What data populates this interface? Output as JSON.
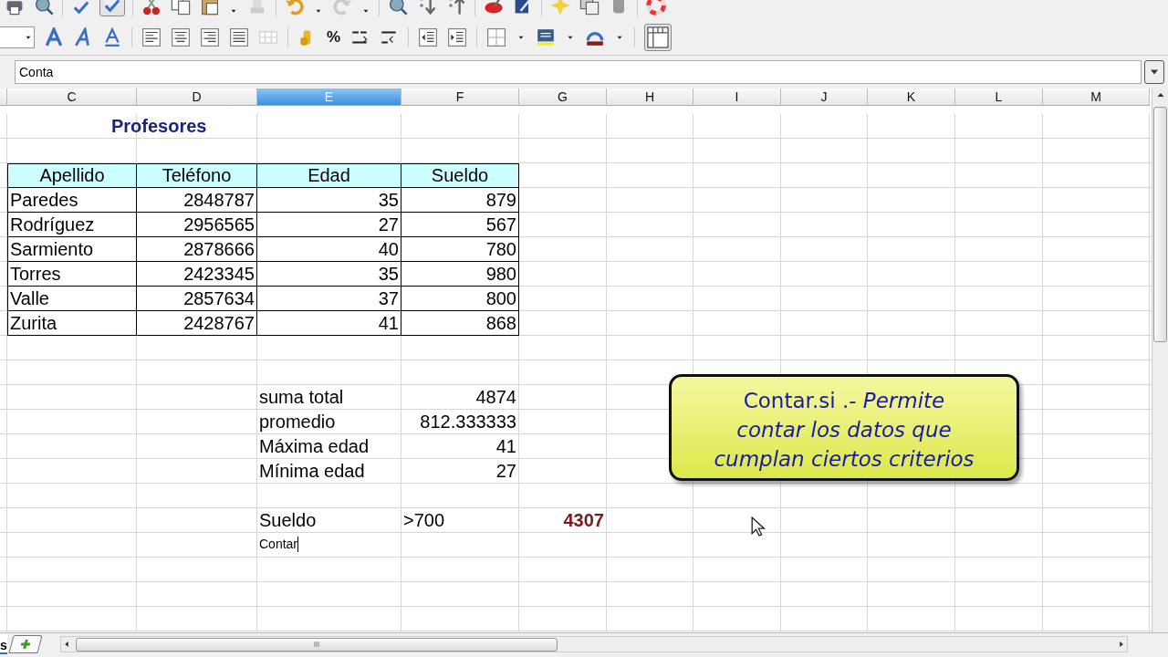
{
  "formula_bar": {
    "value": "Conta"
  },
  "toolbar": {
    "percent": "%"
  },
  "columns": [
    {
      "label": "C",
      "selected": false
    },
    {
      "label": "D",
      "selected": false
    },
    {
      "label": "E",
      "selected": true
    },
    {
      "label": "F",
      "selected": false
    },
    {
      "label": "G",
      "selected": false
    },
    {
      "label": "H",
      "selected": false
    },
    {
      "label": "I",
      "selected": false
    },
    {
      "label": "J",
      "selected": false
    },
    {
      "label": "K",
      "selected": false
    },
    {
      "label": "L",
      "selected": false
    },
    {
      "label": "M",
      "selected": false
    }
  ],
  "rows": [
    {
      "cells": [
        {
          "kind": "title",
          "text": "Profesores"
        }
      ]
    },
    {
      "cells": []
    },
    {
      "cells": [
        {
          "kind": "header",
          "text": "Apellido"
        },
        {
          "kind": "header",
          "text": "Teléfono"
        },
        {
          "kind": "header",
          "text": "Edad"
        },
        {
          "kind": "header",
          "text": "Sueldo"
        }
      ]
    },
    {
      "cells": [
        {
          "kind": "text",
          "text": "Paredes"
        },
        {
          "kind": "number",
          "text": "2848787"
        },
        {
          "kind": "number",
          "text": "35"
        },
        {
          "kind": "number",
          "text": "879"
        }
      ]
    },
    {
      "cells": [
        {
          "kind": "text",
          "text": "Rodríguez"
        },
        {
          "kind": "number",
          "text": "2956565"
        },
        {
          "kind": "number",
          "text": "27"
        },
        {
          "kind": "number",
          "text": "567"
        }
      ]
    },
    {
      "cells": [
        {
          "kind": "text",
          "text": "Sarmiento"
        },
        {
          "kind": "number",
          "text": "2878666"
        },
        {
          "kind": "number",
          "text": "40"
        },
        {
          "kind": "number",
          "text": "780"
        }
      ]
    },
    {
      "cells": [
        {
          "kind": "text",
          "text": "Torres"
        },
        {
          "kind": "number",
          "text": "2423345"
        },
        {
          "kind": "number",
          "text": "35"
        },
        {
          "kind": "number",
          "text": "980"
        }
      ]
    },
    {
      "cells": [
        {
          "kind": "text",
          "text": "Valle"
        },
        {
          "kind": "number",
          "text": "2857634"
        },
        {
          "kind": "number",
          "text": "37"
        },
        {
          "kind": "number",
          "text": "800"
        }
      ]
    },
    {
      "cells": [
        {
          "kind": "text",
          "text": "Zurita"
        },
        {
          "kind": "number",
          "text": "2428767"
        },
        {
          "kind": "number",
          "text": "41"
        },
        {
          "kind": "number",
          "text": "868"
        }
      ]
    },
    {
      "cells": []
    },
    {
      "cells": []
    },
    {
      "cells": [
        {
          "kind": "empty"
        },
        {
          "kind": "empty"
        },
        {
          "kind": "label",
          "text": "suma total"
        },
        {
          "kind": "value",
          "text": "4874"
        }
      ]
    },
    {
      "cells": [
        {
          "kind": "empty"
        },
        {
          "kind": "empty"
        },
        {
          "kind": "label",
          "text": "promedio"
        },
        {
          "kind": "value",
          "text": "812.333333"
        }
      ]
    },
    {
      "cells": [
        {
          "kind": "empty"
        },
        {
          "kind": "empty"
        },
        {
          "kind": "label",
          "text": "Máxima edad"
        },
        {
          "kind": "value",
          "text": "41"
        }
      ]
    },
    {
      "cells": [
        {
          "kind": "empty"
        },
        {
          "kind": "empty"
        },
        {
          "kind": "label",
          "text": "Mínima edad"
        },
        {
          "kind": "value",
          "text": "27"
        }
      ]
    },
    {
      "cells": []
    },
    {
      "cells": [
        {
          "kind": "empty"
        },
        {
          "kind": "empty"
        },
        {
          "kind": "label",
          "text": "Sueldo"
        },
        {
          "kind": "label",
          "text": ">700"
        },
        {
          "kind": "result",
          "text": "4307"
        }
      ]
    },
    {
      "cells": [
        {
          "kind": "empty"
        },
        {
          "kind": "empty"
        },
        {
          "kind": "editing",
          "text": "Contar"
        }
      ]
    },
    {
      "cells": []
    },
    {
      "cells": []
    },
    {
      "cells": []
    }
  ],
  "callout": {
    "text": "Contar.si .- *Permite contar los datos que cumplan ciertos criterios*"
  },
  "sheet_tabs": [
    {
      "label": "s",
      "selected": true
    }
  ]
}
